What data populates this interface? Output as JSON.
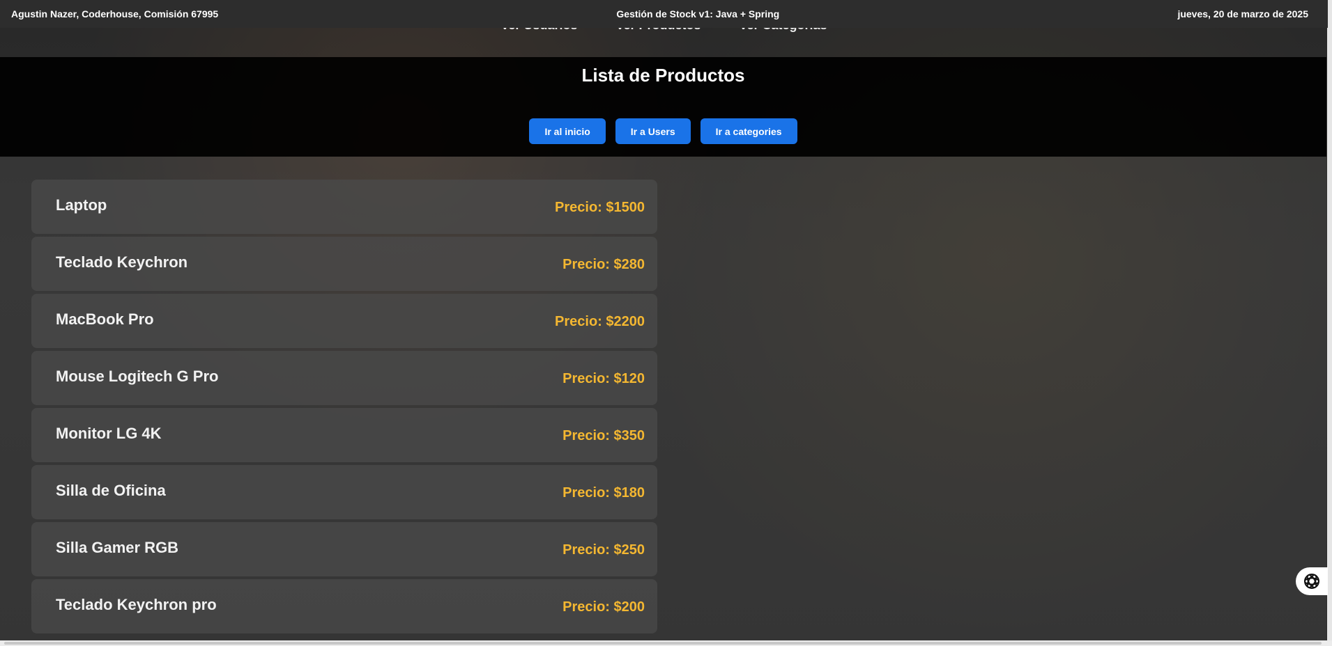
{
  "topbar": {
    "left": "Agustin Nazer, Coderhouse, Comisión 67995",
    "center": "Gestión de Stock v1: Java + Spring",
    "right": "jueves, 20 de marzo de 2025"
  },
  "nav": {
    "items": [
      "Ver Usuarios",
      "Ver Productos",
      "Ver Categorias"
    ]
  },
  "page": {
    "title": "Lista de Productos"
  },
  "buttons": {
    "home": "Ir al inicio",
    "users": "Ir a Users",
    "categories": "Ir a categories"
  },
  "products": [
    {
      "name": "Laptop",
      "price": "Precio: $1500"
    },
    {
      "name": "Teclado Keychron",
      "price": "Precio: $280"
    },
    {
      "name": "MacBook Pro",
      "price": "Precio: $2200"
    },
    {
      "name": "Mouse Logitech G Pro",
      "price": "Precio: $120"
    },
    {
      "name": "Monitor LG 4K",
      "price": "Precio: $350"
    },
    {
      "name": "Silla de Oficina",
      "price": "Precio: $180"
    },
    {
      "name": "Silla Gamer RGB",
      "price": "Precio: $250"
    },
    {
      "name": "Teclado Keychron pro",
      "price": "Precio: $200"
    }
  ],
  "colors": {
    "accent": "#1a73e8",
    "price": "#f4b731",
    "header_bg": "#000000"
  },
  "icons": {
    "assistant": "openai-icon"
  }
}
